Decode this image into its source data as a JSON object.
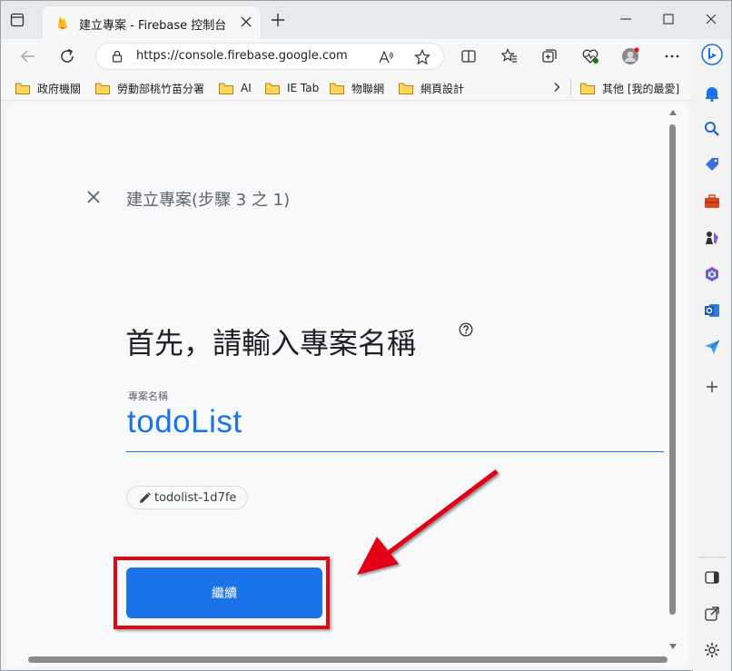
{
  "tab": {
    "title": "建立專案 - Firebase 控制台"
  },
  "toolbar": {
    "url": "https://console.firebase.google.com"
  },
  "favorites": [
    {
      "label": "政府機關"
    },
    {
      "label": "勞動部桃竹苗分署"
    },
    {
      "label": "AI"
    },
    {
      "label": "IE Tab"
    },
    {
      "label": "物聯網"
    },
    {
      "label": "網頁設計"
    }
  ],
  "favorites_other": "其他 [我的最愛]",
  "page": {
    "step_title": "建立專案(步驟 3 之 1)",
    "heading": "首先，請輸入專案名稱",
    "field_label": "專案名稱",
    "field_value": "todoList",
    "project_id": "todolist-1d7fe",
    "continue_label": "繼續"
  },
  "colors": {
    "accent": "#1a73e8",
    "annotation": "#e30613"
  }
}
